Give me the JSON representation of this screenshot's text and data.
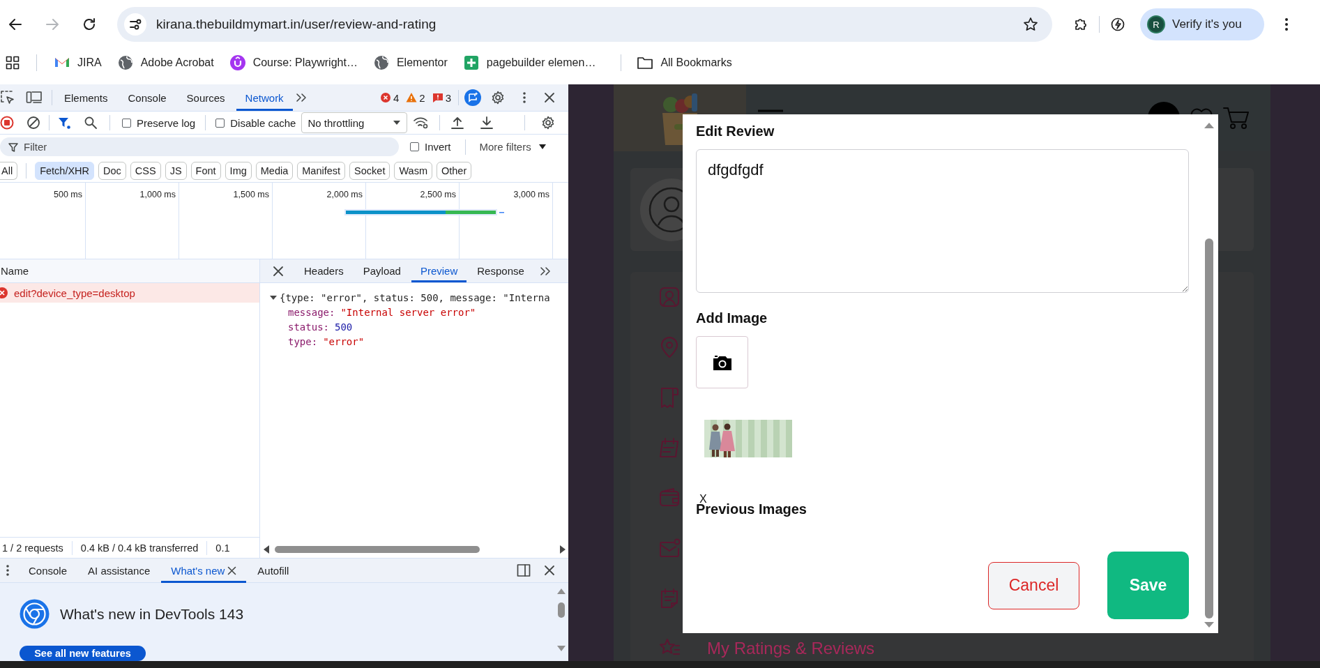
{
  "browser": {
    "nav": [
      {
        "kind": "back",
        "disabled": false
      },
      {
        "kind": "forward",
        "disabled": true
      },
      {
        "kind": "reload",
        "disabled": false
      }
    ],
    "url": "kirana.thebuildmymart.in/user/review-and-rating",
    "profile": {
      "initial": "R",
      "label": "Verify it's you"
    }
  },
  "bookmarks": {
    "items": [
      {
        "kind": "gmail",
        "label": "JIRA"
      },
      {
        "kind": "globe",
        "label": "Adobe Acrobat"
      },
      {
        "kind": "course",
        "label": "Course: Playwright…"
      },
      {
        "kind": "globe",
        "label": "Elementor"
      },
      {
        "kind": "sheet",
        "label": "pagebuilder elemen…"
      }
    ],
    "all": "All Bookmarks"
  },
  "devtools": {
    "tabs": [
      {
        "label": "Elements",
        "selected": false
      },
      {
        "label": "Console",
        "selected": false
      },
      {
        "label": "Sources",
        "selected": false
      },
      {
        "label": "Network",
        "selected": true
      }
    ],
    "counts": [
      {
        "kind": "error",
        "count": "4"
      },
      {
        "kind": "warning",
        "count": "2"
      },
      {
        "kind": "issue",
        "count": "3"
      }
    ],
    "toolbar": {
      "recording": true,
      "preserve_log": {
        "label": "Preserve log",
        "checked": false
      },
      "disable_cache": {
        "label": "Disable cache",
        "checked": false
      },
      "throttling": "No throttling"
    },
    "filter": {
      "placeholder": "Filter",
      "invert": {
        "label": "Invert",
        "checked": false
      },
      "more": "More filters"
    },
    "types": [
      {
        "label": "All",
        "selected": false
      },
      {
        "label": "Fetch/XHR",
        "selected": true
      },
      {
        "label": "Doc",
        "selected": false
      },
      {
        "label": "CSS",
        "selected": false
      },
      {
        "label": "JS",
        "selected": false
      },
      {
        "label": "Font",
        "selected": false
      },
      {
        "label": "Img",
        "selected": false
      },
      {
        "label": "Media",
        "selected": false
      },
      {
        "label": "Manifest",
        "selected": false
      },
      {
        "label": "Socket",
        "selected": false
      },
      {
        "label": "Wasm",
        "selected": false
      },
      {
        "label": "Other",
        "selected": false
      }
    ],
    "timeline": {
      "ticks": [
        "500 ms",
        "1,000 ms",
        "1,500 ms",
        "2,000 ms",
        "2,500 ms",
        "3,000 ms"
      ]
    },
    "requests": {
      "column": "Name",
      "rows": [
        {
          "name": "edit?device_type=desktop",
          "failed": true
        }
      ]
    },
    "details": {
      "tabs": [
        {
          "label": "Headers",
          "selected": false
        },
        {
          "label": "Payload",
          "selected": false
        },
        {
          "label": "Preview",
          "selected": true
        },
        {
          "label": "Response",
          "selected": false
        }
      ],
      "preview": {
        "summary": "{type: \"error\", status: 500, message: \"Interna",
        "expanded": true,
        "properties": [
          {
            "key": "message:",
            "value": "\"Internal server error\"",
            "kind": "string"
          },
          {
            "key": "status:",
            "value": "500",
            "kind": "number"
          },
          {
            "key": "type:",
            "value": "\"error\"",
            "kind": "string"
          }
        ]
      }
    },
    "status_bar": [
      "1 / 2 requests",
      "0.4 kB / 0.4 kB transferred",
      "0.1"
    ],
    "drawer": {
      "tabs": [
        {
          "label": "Console",
          "selected": false,
          "closable": false
        },
        {
          "label": "AI assistance",
          "selected": false,
          "closable": false
        },
        {
          "label": "What's new",
          "selected": true,
          "closable": true
        },
        {
          "label": "Autofill",
          "selected": false,
          "closable": false
        }
      ],
      "title": "What's new in DevTools 143",
      "button": "See all new features"
    }
  },
  "page": {
    "menu": [
      {
        "kind": "person"
      },
      {
        "kind": "location"
      },
      {
        "kind": "receipt"
      },
      {
        "kind": "calendar"
      },
      {
        "kind": "wallet"
      },
      {
        "kind": "mail"
      },
      {
        "kind": "note"
      },
      {
        "kind": "star",
        "label": "My Ratings & Reviews"
      }
    ]
  },
  "modal": {
    "title": "Edit Review",
    "review": "dfgdfgdf",
    "add_image": "Add Image",
    "new_images": [
      {
        "kind": "picture",
        "remove": "X"
      }
    ],
    "previous_images": "Previous Images",
    "cancel": "Cancel",
    "save": "Save"
  }
}
